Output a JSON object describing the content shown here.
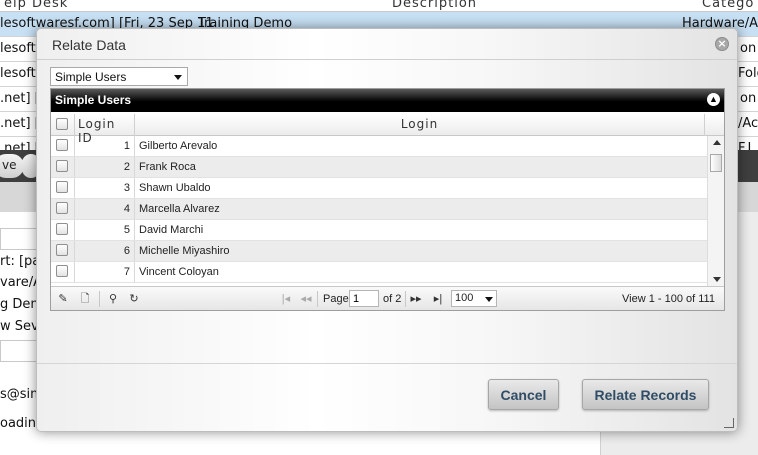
{
  "background": {
    "columns": [
      "elp Desk",
      "Description",
      "Catego"
    ],
    "rows": [
      {
        "col1": "lesoftwaresf.com] [Fri, 23 Sep 11",
        "col2": "Training Demo",
        "col3": "Hardware/Ac"
      },
      {
        "col1": "lesoftw",
        "col3": "on"
      },
      {
        "col1": "lesoftw",
        "col3": "Fold"
      },
      {
        "col1": ".net] [",
        "col3": "on"
      },
      {
        "col1": ".net] [",
        "col3": "/Ac"
      },
      {
        "col1": ".net] [",
        "col3": "F.I"
      }
    ],
    "toolbar": {
      "btn1": "ve",
      "btn2": ""
    },
    "fields": [
      "rt: [pat",
      "vare/Ac",
      "g Dem",
      "w Seve",
      "s@sim",
      "oading"
    ]
  },
  "dialog": {
    "title": "Relate Data",
    "close_icon": "×",
    "select_value": "Simple Users",
    "grid": {
      "caption": "Simple Users",
      "toggle_icon": "▲",
      "headers": {
        "login_id": "Login ID",
        "login": "Login"
      },
      "rows": [
        {
          "id": "1",
          "login": "Gilberto Arevalo"
        },
        {
          "id": "2",
          "login": "Frank Roca"
        },
        {
          "id": "3",
          "login": "Shawn Ubaldo"
        },
        {
          "id": "4",
          "login": "Marcella Alvarez"
        },
        {
          "id": "5",
          "login": "David Marchi"
        },
        {
          "id": "6",
          "login": "Michelle Miyashiro"
        },
        {
          "id": "7",
          "login": "Vincent Coloyan"
        }
      ],
      "pager": {
        "edit_icon": "✎",
        "new_icon": "🗋",
        "search_icon": "⚲",
        "refresh_icon": "↻",
        "first_icon": "|◂",
        "prev_icon": "◂◂",
        "page_label": "Page",
        "page_value": "1",
        "of_label": "of 2",
        "next_icon": "▸▸",
        "last_icon": "▸|",
        "page_size": "100",
        "view_text": "View 1 - 100 of 111"
      }
    },
    "buttons": {
      "cancel": "Cancel",
      "relate": "Relate Records"
    }
  }
}
